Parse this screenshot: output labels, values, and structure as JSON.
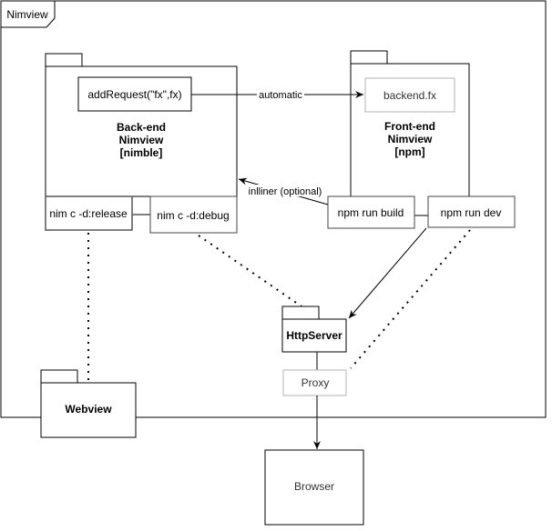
{
  "frame": {
    "title": "Nimview"
  },
  "backend": {
    "title_lines": [
      "Back-end",
      "Nimview",
      "[nimble]"
    ],
    "method": "addRequest(\"fx\",fx)",
    "release": "nim c -d:release",
    "debug": "nim c -d:debug"
  },
  "frontend": {
    "title_lines": [
      "Front-end",
      "Nimview",
      "[npm]"
    ],
    "file": "backend.fx",
    "build": "npm run build",
    "dev": "npm run dev"
  },
  "edges": {
    "automatic": "automatic",
    "inliner": "inlliner (optional)"
  },
  "httpserver": "HttpServer",
  "proxy": "Proxy",
  "webview": "Webview",
  "browser": "Browser"
}
